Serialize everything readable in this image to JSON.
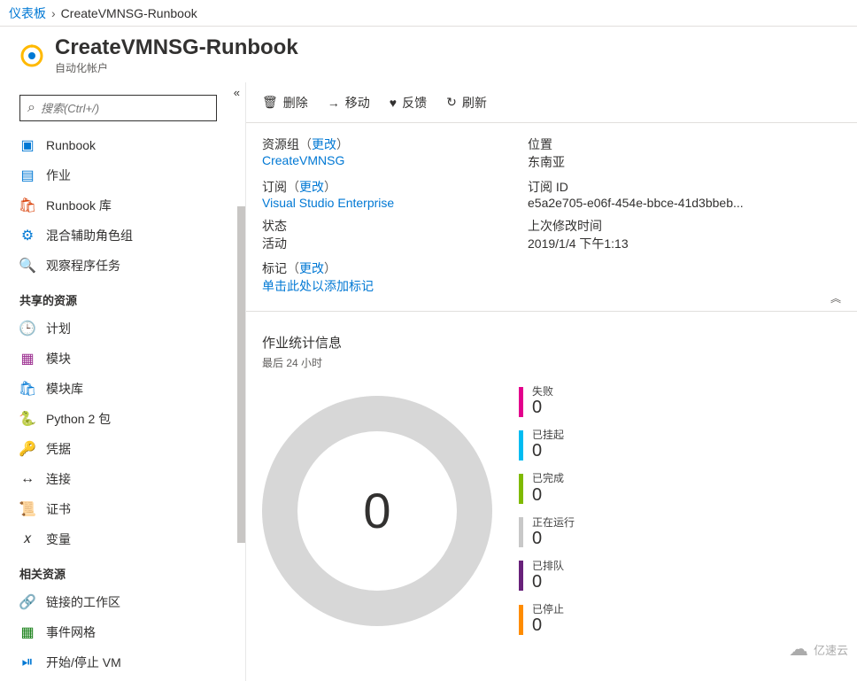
{
  "breadcrumb": {
    "root": "仪表板",
    "current": "CreateVMNSG-Runbook"
  },
  "header": {
    "title": "CreateVMNSG-Runbook",
    "subtitle": "自动化帐户"
  },
  "search": {
    "placeholder": "搜索(Ctrl+/)"
  },
  "sidebar": {
    "items": [
      {
        "icon": "runbook-icon",
        "label": "Runbook",
        "color": "#0078d4",
        "glyph": "▣"
      },
      {
        "icon": "jobs-icon",
        "label": "作业",
        "color": "#0078d4",
        "glyph": "▤"
      },
      {
        "icon": "runbook-gallery-icon",
        "label": "Runbook 库",
        "color": "#d83b01",
        "glyph": "🛍"
      },
      {
        "icon": "hybrid-worker-icon",
        "label": "混合辅助角色组",
        "color": "#0078d4",
        "glyph": "⚙"
      },
      {
        "icon": "watcher-icon",
        "label": "观察程序任务",
        "color": "#0078d4",
        "glyph": "🔍"
      }
    ],
    "sharedHeader": "共享的资源",
    "shared": [
      {
        "icon": "schedule-icon",
        "label": "计划",
        "color": "#0078d4",
        "glyph": "🕒"
      },
      {
        "icon": "modules-icon",
        "label": "模块",
        "color": "#9b2d8f",
        "glyph": "▦"
      },
      {
        "icon": "modules-gallery-icon",
        "label": "模块库",
        "color": "#0078d4",
        "glyph": "🛍"
      },
      {
        "icon": "python-icon",
        "label": "Python 2 包",
        "color": "#3572A5",
        "glyph": "🐍"
      },
      {
        "icon": "credentials-icon",
        "label": "凭据",
        "color": "#f2c811",
        "glyph": "🔑"
      },
      {
        "icon": "connections-icon",
        "label": "连接",
        "color": "#323130",
        "glyph": "↔"
      },
      {
        "icon": "certificates-icon",
        "label": "证书",
        "color": "#e3a21a",
        "glyph": "📜"
      },
      {
        "icon": "variables-icon",
        "label": "变量",
        "color": "#323130",
        "glyph": "𝑥"
      }
    ],
    "relatedHeader": "相关资源",
    "related": [
      {
        "icon": "linked-workspace-icon",
        "label": "链接的工作区",
        "color": "#0078d4",
        "glyph": "🔗"
      },
      {
        "icon": "event-grid-icon",
        "label": "事件网格",
        "color": "#107c10",
        "glyph": "▦"
      },
      {
        "icon": "startstop-vm-icon",
        "label": "开始/停止 VM",
        "color": "#0078d4",
        "glyph": "⏯"
      }
    ]
  },
  "toolbar": {
    "delete": "删除",
    "move": "移动",
    "feedback": "反馈",
    "refresh": "刷新"
  },
  "essentials": {
    "resourceGroupLabel": "资源组",
    "changeText": "更改",
    "resourceGroup": "CreateVMNSG",
    "subscriptionLabel": "订阅",
    "subscription": "Visual Studio Enterprise",
    "statusLabel": "状态",
    "status": "活动",
    "tagsLabel": "标记",
    "tagsAdd": "单击此处以添加标记",
    "locationLabel": "位置",
    "location": "东南亚",
    "subIdLabel": "订阅 ID",
    "subId": "e5a2e705-e06f-454e-bbce-41d3bbeb...",
    "lastModifiedLabel": "上次修改时间",
    "lastModified": "2019/1/4 下午1:13"
  },
  "chart_data": {
    "type": "pie",
    "title": "作业统计信息",
    "subtitle": "最后 24 小时",
    "total": 0,
    "series": [
      {
        "name": "失败",
        "value": 0,
        "color": "#e3008c"
      },
      {
        "name": "已挂起",
        "value": 0,
        "color": "#00bcf2"
      },
      {
        "name": "已完成",
        "value": 0,
        "color": "#7fba00"
      },
      {
        "name": "正在运行",
        "value": 0,
        "color": "#c8c8c8"
      },
      {
        "name": "已排队",
        "value": 0,
        "color": "#68217a"
      },
      {
        "name": "已停止",
        "value": 0,
        "color": "#ff8c00"
      }
    ]
  },
  "watermark": "亿速云"
}
